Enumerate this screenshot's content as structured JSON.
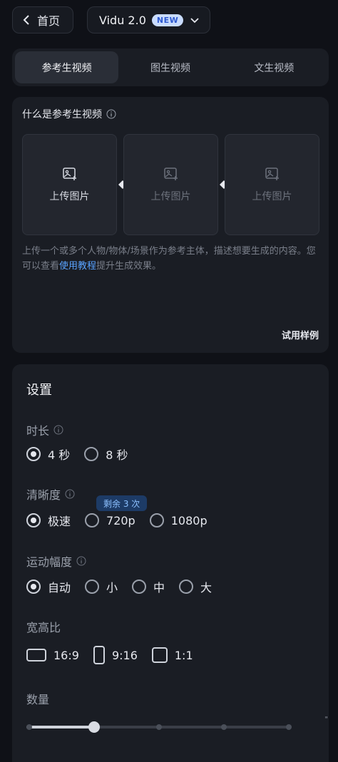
{
  "header": {
    "back_label": "首页",
    "model_name": "Vidu 2.0",
    "model_badge": "NEW"
  },
  "tabs": [
    {
      "label": "参考生视频",
      "active": true
    },
    {
      "label": "图生视频",
      "active": false
    },
    {
      "label": "文生视频",
      "active": false
    }
  ],
  "reference": {
    "title": "什么是参考生视频",
    "uploads": [
      {
        "label": "上传图片",
        "enabled": true
      },
      {
        "label": "上传图片",
        "enabled": false
      },
      {
        "label": "上传图片",
        "enabled": false
      }
    ],
    "desc_before": "上传一个或多个人物/物体/场景作为参考主体，描述想要生成的内容。您可以查看",
    "desc_link": "使用教程",
    "desc_after": "提升生成效果。",
    "try_sample": "试用样例"
  },
  "settings": {
    "title": "设置",
    "duration": {
      "label": "时长",
      "options": [
        "4 秒",
        "8 秒"
      ],
      "selected": "4 秒"
    },
    "quality": {
      "label": "清晰度",
      "badge": "剩余 3 次",
      "options": [
        "极速",
        "720p",
        "1080p"
      ],
      "selected": "极速"
    },
    "motion": {
      "label": "运动幅度",
      "options": [
        "自动",
        "小",
        "中",
        "大"
      ],
      "selected": "自动"
    },
    "ratio": {
      "label": "宽高比",
      "options": [
        "16:9",
        "9:16",
        "1:1"
      ]
    },
    "quantity": {
      "label": "数量",
      "value": 2,
      "steps": 5
    }
  },
  "colors": {
    "accent_link": "#5aa3ff",
    "badge_bg": "#1d3b66"
  }
}
